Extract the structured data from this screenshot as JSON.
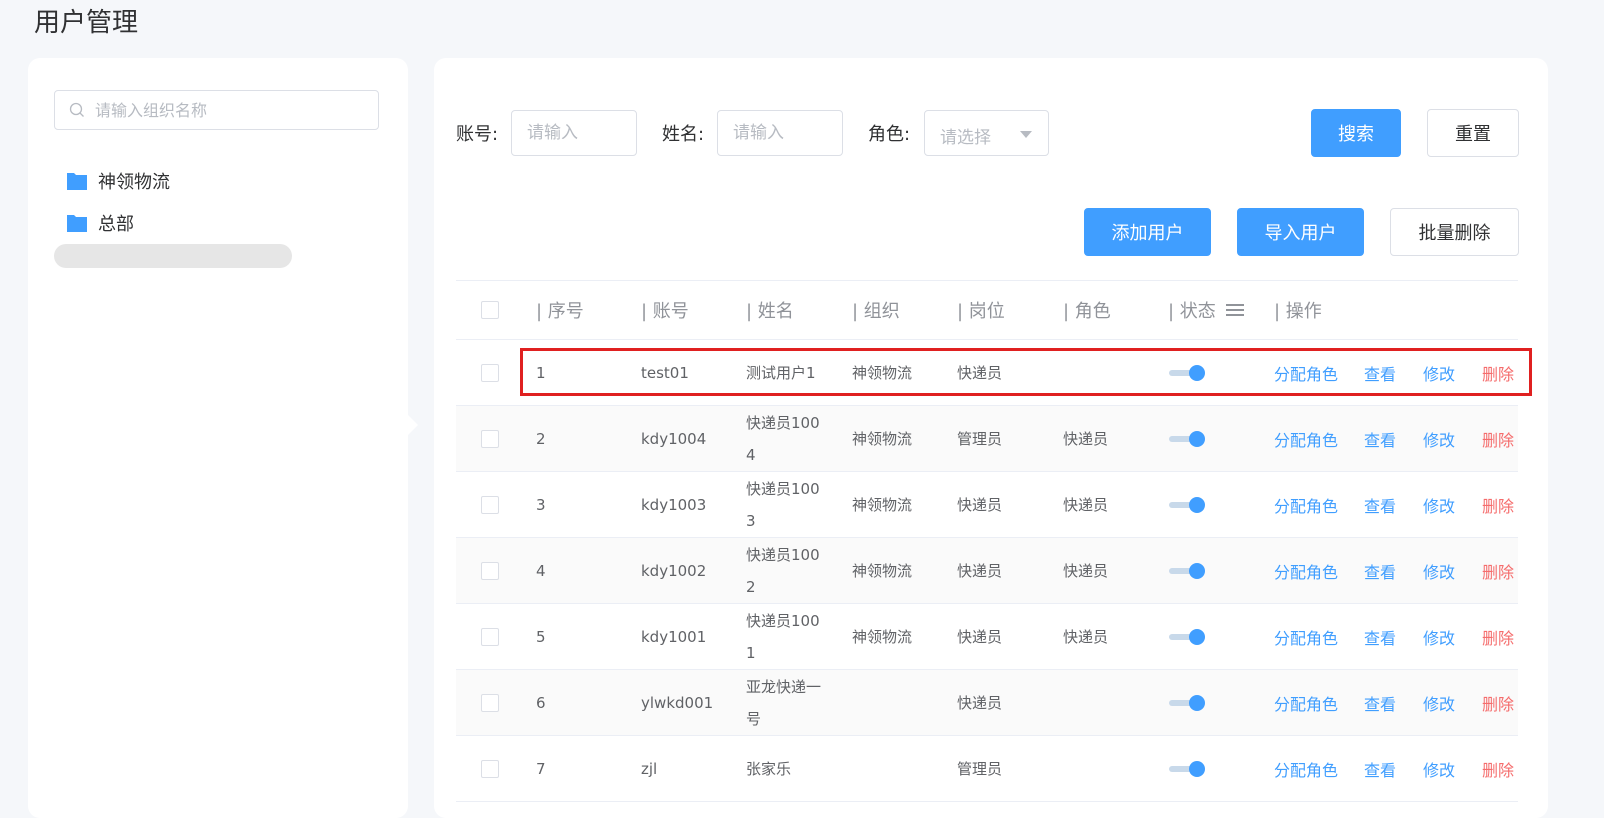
{
  "page": {
    "title": "用户管理"
  },
  "org_tree": {
    "search_placeholder": "请输入组织名称",
    "items": [
      {
        "label": "神领物流"
      },
      {
        "label": "总部"
      }
    ]
  },
  "filters": {
    "account_label": "账号:",
    "account_placeholder": "请输入",
    "name_label": "姓名:",
    "name_placeholder": "请输入",
    "role_label": "角色:",
    "role_placeholder": "请选择",
    "search_button": "搜索",
    "reset_button": "重置"
  },
  "actions": {
    "add_user": "添加用户",
    "import_user": "导入用户",
    "batch_delete": "批量删除"
  },
  "table": {
    "headers": {
      "index": "| 序号",
      "account": "| 账号",
      "name": "| 姓名",
      "org": "| 组织",
      "position": "| 岗位",
      "role": "| 角色",
      "status": "| 状态",
      "ops": "| 操作"
    },
    "op_labels": {
      "assign_role": "分配角色",
      "view": "查看",
      "edit": "修改",
      "delete": "删除"
    },
    "rows": [
      {
        "index": "1",
        "account": "test01",
        "name": "测试用户1",
        "org": "神领物流",
        "position": "快递员",
        "role": "",
        "status": true
      },
      {
        "index": "2",
        "account": "kdy1004",
        "name": "快递员100\n4",
        "org": "神领物流",
        "position": "管理员",
        "role": "快递员",
        "status": true
      },
      {
        "index": "3",
        "account": "kdy1003",
        "name": "快递员100\n3",
        "org": "神领物流",
        "position": "快递员",
        "role": "快递员",
        "status": true
      },
      {
        "index": "4",
        "account": "kdy1002",
        "name": "快递员100\n2",
        "org": "神领物流",
        "position": "快递员",
        "role": "快递员",
        "status": true
      },
      {
        "index": "5",
        "account": "kdy1001",
        "name": "快递员100\n1",
        "org": "神领物流",
        "position": "快递员",
        "role": "快递员",
        "status": true
      },
      {
        "index": "6",
        "account": "ylwkd001",
        "name": "亚龙快递一\n号",
        "org": "",
        "position": "快递员",
        "role": "",
        "status": true
      },
      {
        "index": "7",
        "account": "zjl",
        "name": "张家乐",
        "org": "",
        "position": "管理员",
        "role": "",
        "status": true
      }
    ]
  },
  "colors": {
    "primary": "#409eff",
    "danger": "#f56c6c",
    "highlight": "#e02020"
  },
  "icons": {
    "search": "search-icon",
    "folder": "folder-icon",
    "menu": "menu-icon"
  }
}
